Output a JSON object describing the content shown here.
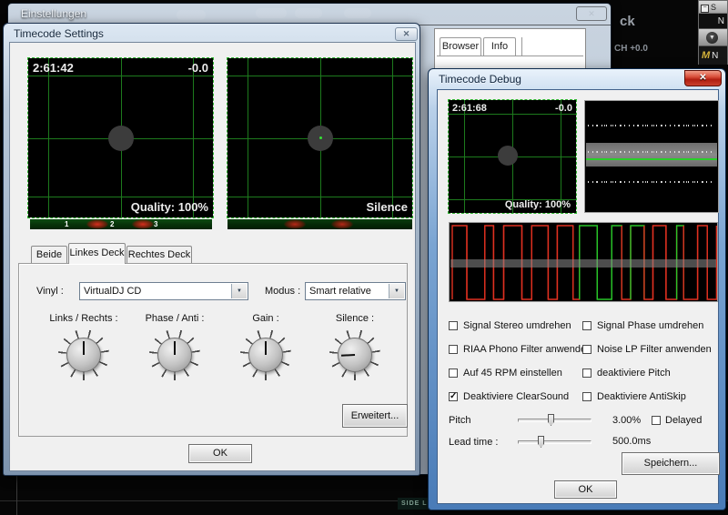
{
  "colors": {
    "scope_grid": "#1d7a1d",
    "scope_edge": "#2fb52f",
    "osc_red": "#e03020",
    "osc_green": "#28c428",
    "strip_green": "#0a3d0c",
    "strip_red": "#b01f12",
    "debug_close_red": "#b01e10"
  },
  "app": {
    "deck_fragment": "ck",
    "ch_level": "CH +0.0",
    "side_list": "SIDE LIST",
    "sidebar": {
      "header": "S",
      "collapse_glyph": "−",
      "row_n1": "N",
      "arrow_glyph": "▼",
      "m_label": "M",
      "row_n2": "N"
    }
  },
  "einstellungen": {
    "title": "Einstellungen",
    "close_glyph": "✕",
    "tabs": {
      "browser": "Browser",
      "info": "Info"
    }
  },
  "timecode_settings": {
    "title": "Timecode Settings",
    "close_glyph": "✕",
    "left_scope": {
      "time": "2:61:42",
      "offset": "-0.0",
      "quality": "Quality: 100%"
    },
    "right_scope": {
      "status": "Silence"
    },
    "cue_markers": [
      "1",
      "2",
      "3"
    ],
    "tabs": [
      {
        "label": "Beide",
        "active": false
      },
      {
        "label": "Linkes Deck",
        "active": true
      },
      {
        "label": "Rechtes Deck",
        "active": false
      }
    ],
    "vinyl_label": "Vinyl :",
    "vinyl_value": "VirtualDJ CD",
    "modus_label": "Modus :",
    "modus_value": "Smart relative",
    "dropdown_arrow": "▼",
    "knobs": [
      {
        "label": "Links / Rechts :",
        "angle": 0
      },
      {
        "label": "Phase / Anti :",
        "angle": 0
      },
      {
        "label": "Gain :",
        "angle": 0
      },
      {
        "label": "Silence :",
        "angle": -93
      }
    ],
    "erweitert_label": "Erweitert...",
    "ok_label": "OK"
  },
  "timecode_debug": {
    "title": "Timecode Debug",
    "close_glyph": "✕",
    "scope": {
      "time": "2:61:68",
      "offset": "-0.0",
      "quality": "Quality: 100%"
    },
    "checkboxes": [
      {
        "label": "Signal Stereo umdrehen",
        "checked": false,
        "glyph": ""
      },
      {
        "label": "Signal Phase umdrehen",
        "checked": false,
        "glyph": ""
      },
      {
        "label": "RIAA Phono Filter anwenden",
        "checked": false,
        "glyph": ""
      },
      {
        "label": "Noise LP Filter anwenden",
        "checked": false,
        "glyph": ""
      },
      {
        "label": "Auf 45 RPM einstellen",
        "checked": false,
        "glyph": ""
      },
      {
        "label": "deaktiviere Pitch",
        "checked": false,
        "glyph": ""
      },
      {
        "label": "Deaktiviere ClearSound",
        "checked": true,
        "glyph": "✓"
      },
      {
        "label": "Deaktiviere AntiSkip",
        "checked": false,
        "glyph": ""
      }
    ],
    "pitch": {
      "label": "Pitch",
      "value": "3.00%",
      "delayed_label": "Delayed",
      "delayed_checked": false,
      "delayed_glyph": ""
    },
    "lead_time": {
      "label": "Lead time :",
      "value": "500.0ms"
    },
    "speichern_label": "Speichern...",
    "ok_label": "OK"
  }
}
